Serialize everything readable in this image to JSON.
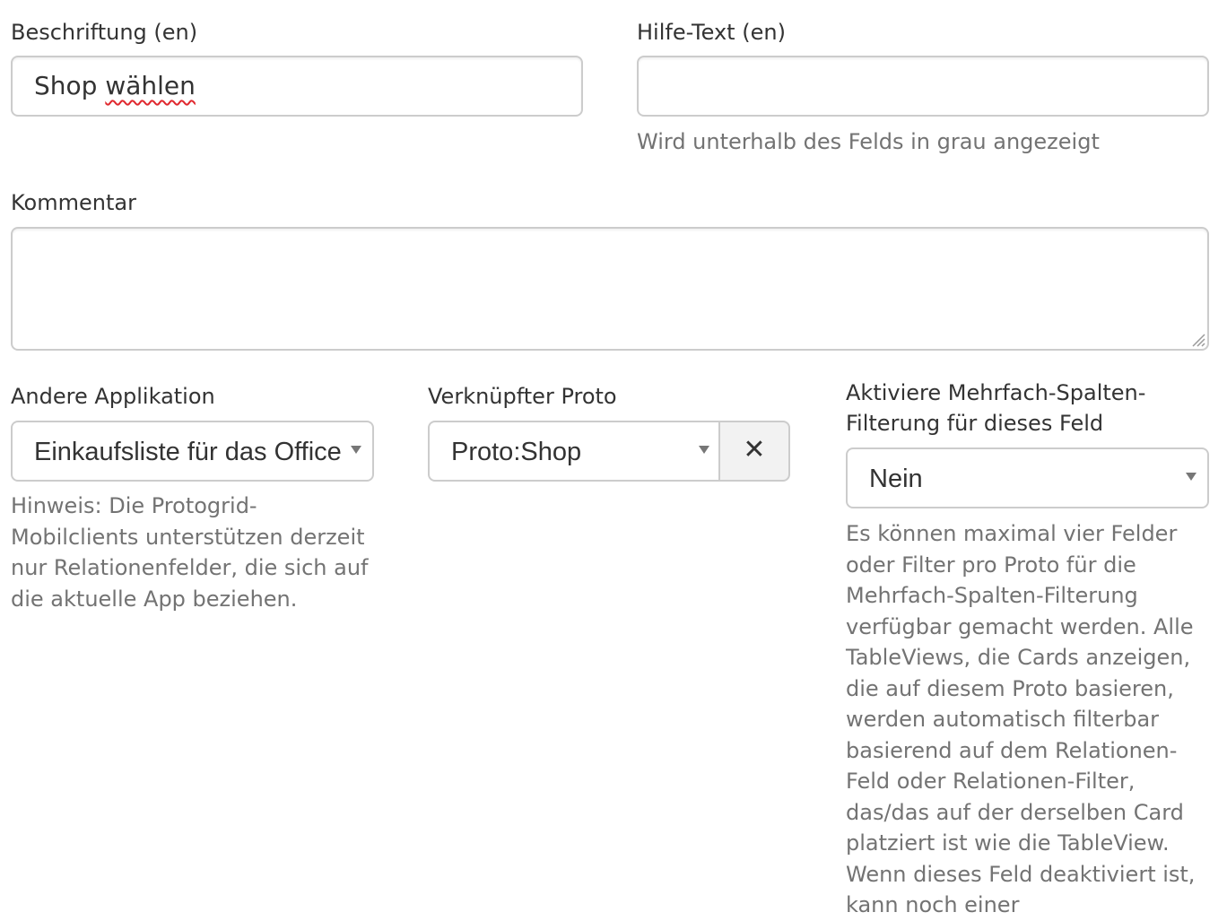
{
  "fields": {
    "label_en": {
      "label": "Beschriftung (en)",
      "value": "Shop ",
      "value_misspelled": "wählen"
    },
    "help_text_en": {
      "label": "Hilfe-Text (en)",
      "value": "",
      "help": "Wird unterhalb des Felds in grau angezeigt"
    },
    "comment": {
      "label": "Kommentar",
      "value": ""
    },
    "other_app": {
      "label": "Andere Applikation",
      "selected": "Einkaufsliste für das Office",
      "help": "Hinweis: Die Protogrid-Mobilclients unterstützen derzeit nur Relationenfelder, die sich auf die aktuelle App beziehen."
    },
    "linked_proto": {
      "label": "Verknüpfter Proto",
      "selected": "Proto:Shop",
      "clear_symbol": "✕"
    },
    "multi_column_filter": {
      "label": "Aktiviere Mehrfach-Spalten-Filterung für dieses Feld",
      "selected": "Nein",
      "help": "Es können maximal vier Felder oder Filter pro Proto für die Mehrfach-Spalten-Filterung verfügbar gemacht werden. Alle TableViews, die Cards anzeigen, die auf diesem Proto basieren, werden automatisch filterbar basierend auf dem Relationen-Feld oder Relationen-Filter, das/das auf der derselben Card platziert ist wie die TableView. Wenn dieses Feld deaktiviert ist, kann noch einer"
    }
  },
  "icons": {
    "dropdown": "chevron-down-icon",
    "clear": "close-icon",
    "resize": "resize-handle-icon"
  },
  "colors": {
    "text": "#333333",
    "help_text": "#737373",
    "border": "#cccccc",
    "spellcheck": "#e0282e"
  }
}
